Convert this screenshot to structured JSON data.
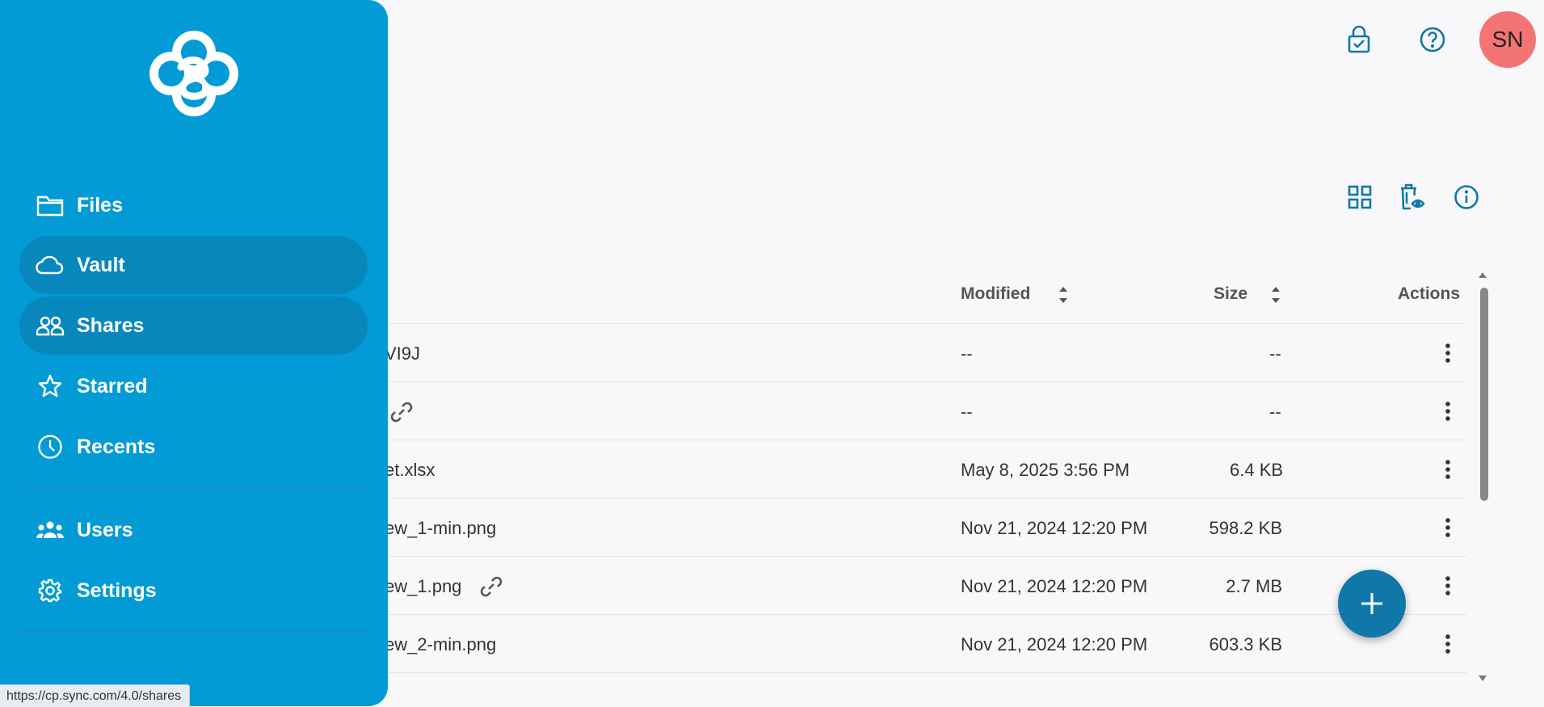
{
  "header": {
    "avatar_initials": "SN",
    "lock_icon": "lock-check-icon",
    "help_icon": "help-circle-icon"
  },
  "toolbar": {
    "grid_icon": "grid-view-icon",
    "deleted_icon": "show-deleted-icon",
    "info_icon": "info-icon"
  },
  "table": {
    "columns": {
      "modified": "Modified",
      "size": "Size",
      "actions": "Actions"
    },
    "rows": [
      {
        "name": "VI9J",
        "modified": "--",
        "size": "--",
        "link": false
      },
      {
        "name": "",
        "modified": "--",
        "size": "--",
        "link": true
      },
      {
        "name": "et.xlsx",
        "modified": "May 8, 2025 3:56 PM",
        "size": "6.4 KB",
        "link": false
      },
      {
        "name": "ew_1-min.png",
        "modified": "Nov 21, 2024 12:20 PM",
        "size": "598.2 KB",
        "link": false
      },
      {
        "name": "ew_1.png",
        "modified": "Nov 21, 2024 12:20 PM",
        "size": "2.7 MB",
        "link": true
      },
      {
        "name": "ew_2-min.png",
        "modified": "Nov 21, 2024 12:20 PM",
        "size": "603.3 KB",
        "link": false
      }
    ]
  },
  "sidebar": {
    "logo": "sync-logo",
    "items": [
      {
        "label": "Files",
        "icon": "folder-icon",
        "active": false
      },
      {
        "label": "Vault",
        "icon": "cloud-icon",
        "active": true
      },
      {
        "label": "Shares",
        "icon": "people-icon",
        "active": true
      },
      {
        "label": "Starred",
        "icon": "star-icon",
        "active": false
      },
      {
        "label": "Recents",
        "icon": "clock-icon",
        "active": false
      },
      {
        "label": "Users",
        "icon": "users-icon",
        "active": false
      },
      {
        "label": "Settings",
        "icon": "gear-icon",
        "active": false
      }
    ]
  },
  "status_bar": {
    "url": "https://cp.sync.com/4.0/shares"
  },
  "colors": {
    "sidebar": "#029bd6",
    "sidebar_active": "#0887bd",
    "accent": "#0f78a8",
    "avatar": "#f47373"
  }
}
